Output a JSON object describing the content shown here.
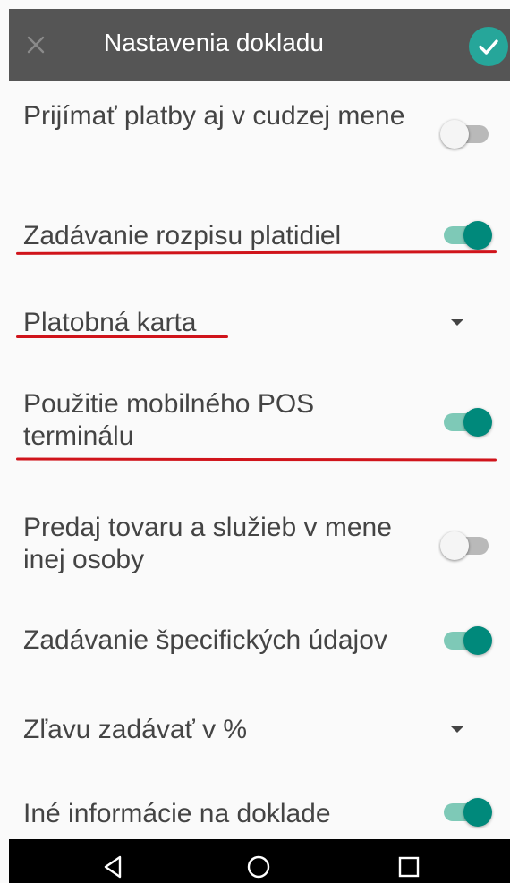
{
  "header": {
    "title": "Nastavenia dokladu",
    "close_icon": "close-icon",
    "confirm_icon": "check-icon",
    "accent_color": "#26a69a"
  },
  "settings": [
    {
      "label": "Prijímať platby aj v cudzej mene",
      "control": "switch",
      "checked": false
    },
    {
      "label": "Zadávanie rozpisu platidiel",
      "control": "switch",
      "checked": true
    },
    {
      "label": "Platobná karta",
      "control": "dropdown"
    },
    {
      "label": "Použitie mobilného POS terminálu",
      "control": "switch",
      "checked": true
    },
    {
      "label": "Predaj tovaru a služieb v mene inej osoby",
      "control": "switch",
      "checked": false
    },
    {
      "label": "Zadávanie špecifických údajov",
      "control": "switch",
      "checked": true
    },
    {
      "label": "Zľavu zadávať v %",
      "control": "dropdown"
    },
    {
      "label": "Iné informácie na doklade",
      "control": "switch",
      "checked": true
    }
  ],
  "annotation_color": "#d0141b",
  "navbar": {
    "back_icon": "back-triangle-icon",
    "home_icon": "home-circle-icon",
    "recents_icon": "recents-square-icon"
  }
}
